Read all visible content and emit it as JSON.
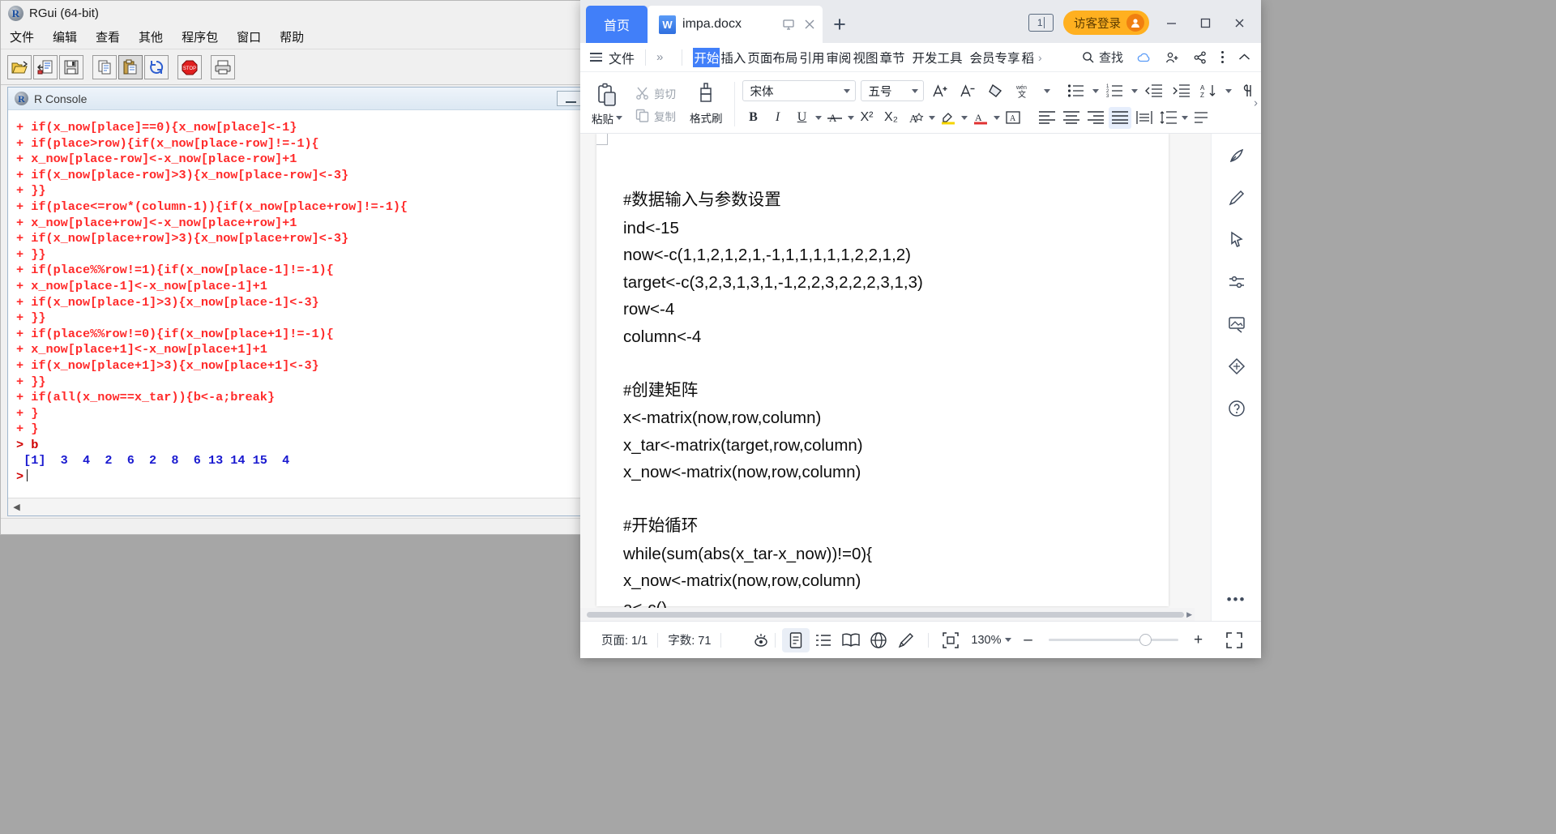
{
  "rgui": {
    "title": "RGui (64-bit)",
    "menu": [
      "文件",
      "编辑",
      "查看",
      "其他",
      "程序包",
      "窗口",
      "帮助"
    ],
    "toolbar_icons": [
      "open-folder-icon",
      "load-workspace-icon",
      "save-icon",
      "copy-icon",
      "paste-icon",
      "copy-paste-icon",
      "stop-icon",
      "print-icon"
    ],
    "console": {
      "title": "R Console",
      "lines": [
        "+ if(x_now[place]==0){x_now[place]<-1}",
        "+ if(place>row){if(x_now[place-row]!=-1){",
        "+ x_now[place-row]<-x_now[place-row]+1",
        "+ if(x_now[place-row]>3){x_now[place-row]<-3}",
        "+ }}",
        "+ if(place<=row*(column-1)){if(x_now[place+row]!=-1){",
        "+ x_now[place+row]<-x_now[place+row]+1",
        "+ if(x_now[place+row]>3){x_now[place+row]<-3}",
        "+ }}",
        "+ if(place%%row!=1){if(x_now[place-1]!=-1){",
        "+ x_now[place-1]<-x_now[place-1]+1",
        "+ if(x_now[place-1]>3){x_now[place-1]<-3}",
        "+ }}",
        "+ if(place%%row!=0){if(x_now[place+1]!=-1){",
        "+ x_now[place+1]<-x_now[place+1]+1",
        "+ if(x_now[place+1]>3){x_now[place+1]<-3}",
        "+ }}",
        "+ if(all(x_now==x_tar)){b<-a;break}",
        "+ }",
        "+ }"
      ],
      "prompt_line": "> b",
      "output_line": " [1]  3  4  2  6  2  8  6 13 14 15  4",
      "final_prompt": ">"
    }
  },
  "wps": {
    "tabs": {
      "home_label": "首页",
      "doc_label": "impa.docx",
      "doc_icon": "W",
      "new_tab_icon": "plus-icon",
      "pin_icon": "pin-window-icon",
      "close_icon": "close-icon"
    },
    "titlebar": {
      "window_count": "1",
      "login_label": "访客登录",
      "minimize": "—",
      "maximize": "▢",
      "close": "✕"
    },
    "menurow": {
      "file_label": "文件",
      "chevrons": "»",
      "ribbon_tabs": [
        {
          "label": "开始",
          "active": true
        },
        {
          "label": "插入",
          "active": false
        },
        {
          "label": "页面布局",
          "active": false
        },
        {
          "label": "引用",
          "active": false
        },
        {
          "label": "审阅",
          "active": false
        },
        {
          "label": "视图",
          "active": false
        },
        {
          "label": "章节",
          "active": false
        },
        {
          "label": "开发工具",
          "active": false
        },
        {
          "label": "会员专享",
          "active": false
        },
        {
          "label": "稻",
          "active": false
        }
      ],
      "more_tabs_icon": "chevron-right-icon",
      "search_label": "查找",
      "cloud_icon": "cloud-icon",
      "share-user_icon": "user-share-icon",
      "share_icon": "share-icon",
      "more_icon": "more-vertical-icon",
      "collapse_icon": "chevron-up-icon"
    },
    "toolbar": {
      "paste_label": "粘贴",
      "cut_label": "剪切",
      "copy_label": "复制",
      "format_painter_label": "格式刷",
      "font_name": "宋体",
      "font_size": "五号",
      "grow_font": "A⁺",
      "shrink_font": "A⁻",
      "clear_format_icon": "clear-format-icon",
      "pinyin_icon": "pinyin-guide-icon",
      "bold": "B",
      "italic": "I",
      "underline": "U",
      "strikethrough": "A",
      "superscript": "X²",
      "subscript": "X₂",
      "char_effect": "A",
      "highlight_icon": "highlight-color-icon",
      "font_color_icon": "font-color-icon",
      "char_border_icon": "char-border-icon",
      "align_left_icon": "align-left-icon",
      "align_center_icon": "align-center-icon",
      "align_right_icon": "align-right-icon",
      "align_justify_icon": "align-justify-icon",
      "align_distribute_icon": "align-distribute-icon",
      "line_spacing_icon": "line-spacing-icon",
      "bullets_icon": "bullets-icon",
      "numbering_icon": "numbering-icon",
      "decrease_indent_icon": "decrease-indent-icon",
      "increase_indent_icon": "increase-indent-icon",
      "sort_icon": "sort-icon",
      "show_marks_icon": "show-paragraph-marks-icon",
      "expand_icon": "expand-ribbon-icon"
    },
    "document": {
      "lines": [
        "#数据输入与参数设置",
        "ind<-15",
        "now<-c(1,1,2,1,2,1,-1,1,1,1,1,1,2,2,1,2)",
        "target<-c(3,2,3,1,3,1,-1,2,2,3,2,2,2,3,1,3)",
        "row<-4",
        "column<-4",
        "",
        "#创建矩阵",
        "x<-matrix(now,row,column)",
        "x_tar<-matrix(target,row,column)",
        "x_now<-matrix(now,row,column)",
        "",
        "#开始循环",
        "while(sum(abs(x_tar-x_now))!=0){",
        "x_now<-matrix(now,row,column)",
        "a<-c()"
      ]
    },
    "sidebar_icons": [
      "clip-board-pen-icon",
      "pen-icon",
      "cursor-icon",
      "settings-slider-icon",
      "image-stamp-icon",
      "diamond-icon",
      "help-icon"
    ],
    "statusbar": {
      "page_label": "页面: 1/1",
      "word_count_label": "字数: 71",
      "eye_icon": "read-aloud-icon",
      "page_view_icon": "page-view-icon",
      "outline_view_icon": "outline-view-icon",
      "read_view_icon": "read-view-icon",
      "web_view_icon": "web-view-icon",
      "edit_icon": "edit-pen-icon",
      "fit_icon": "fit-page-icon",
      "zoom_value": "130%",
      "zoom_out": "–",
      "zoom_in": "+",
      "fullscreen_icon": "fullscreen-icon"
    }
  }
}
